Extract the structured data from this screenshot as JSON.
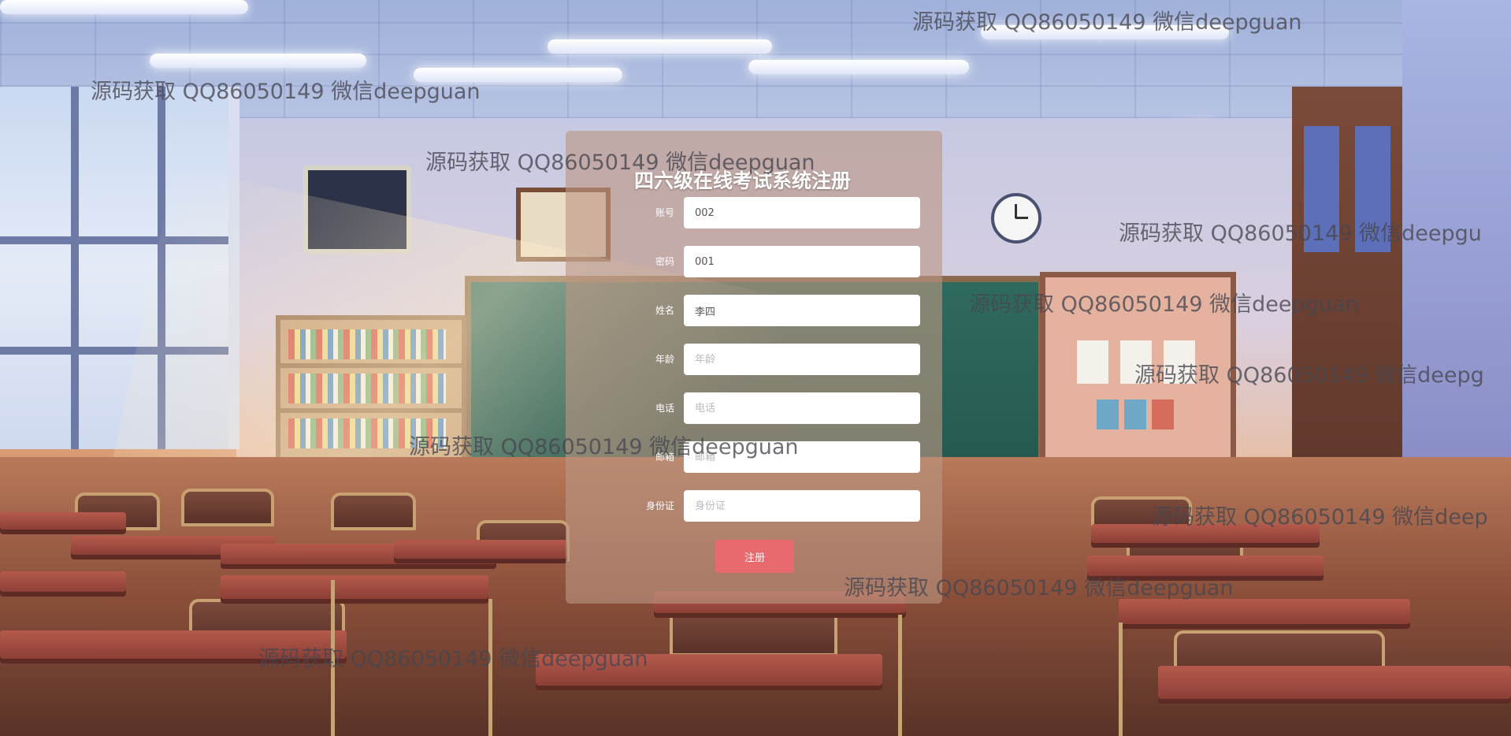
{
  "form": {
    "title": "四六级在线考试系统注册",
    "fields": [
      {
        "label": "账号",
        "value": "002",
        "placeholder": ""
      },
      {
        "label": "密码",
        "value": "001",
        "placeholder": ""
      },
      {
        "label": "姓名",
        "value": "李四",
        "placeholder": ""
      },
      {
        "label": "年龄",
        "value": "",
        "placeholder": "年龄"
      },
      {
        "label": "电话",
        "value": "",
        "placeholder": "电话"
      },
      {
        "label": "邮箱",
        "value": "",
        "placeholder": "邮箱"
      },
      {
        "label": "身份证",
        "value": "",
        "placeholder": "身份证"
      }
    ],
    "submit_label": "注册"
  },
  "watermarks": [
    "源码获取 QQ86050149 微信deepguan",
    "源码获取 QQ86050149 微信deepguan",
    "源码获取 QQ86050149 微信deepguan",
    "源码获取 QQ86050149 微信deepgu",
    "源码获取 QQ86050149 微信deepguan",
    "源码获取 QQ86050149 微信deepg",
    "源码获取 QQ86050149 微信deepguan",
    "源码获取 QQ86050149 微信deep",
    "源码获取 QQ86050149 微信deepguan",
    "源码获取 QQ86050149 微信deepguan"
  ]
}
